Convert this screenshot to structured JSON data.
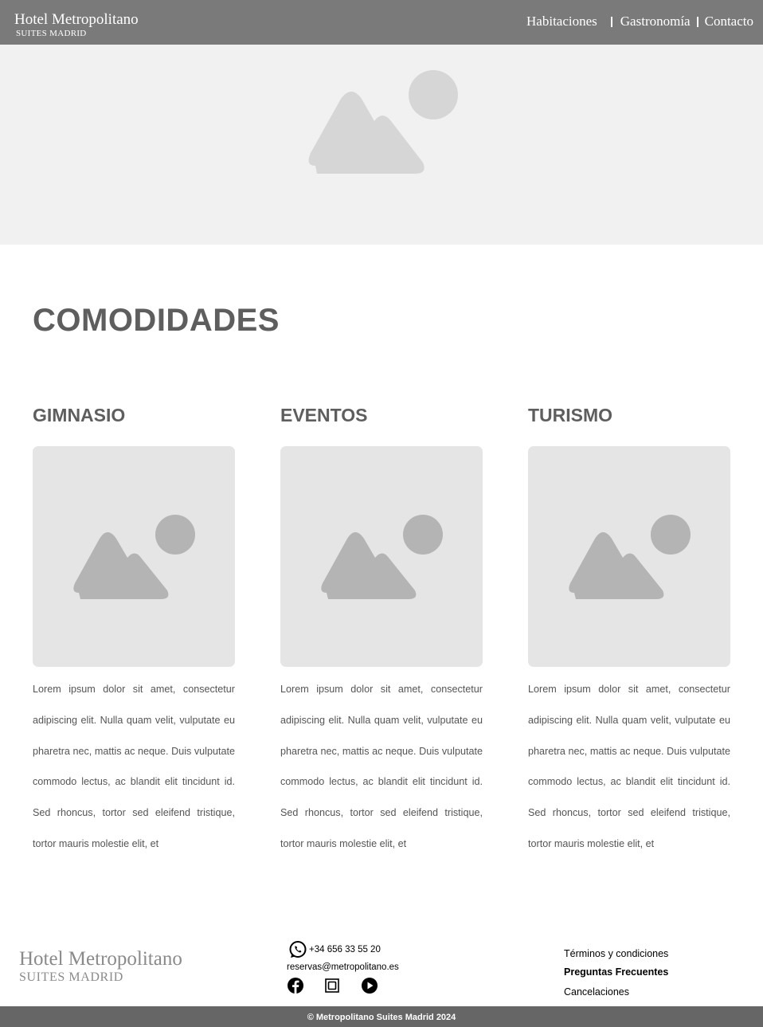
{
  "header": {
    "brand_title": "Hotel Metropolitano",
    "brand_sub": "SUITES MADRID",
    "nav": [
      "Habitaciones",
      "Gastronomía",
      "Contacto"
    ]
  },
  "hero": {
    "image_icon": "image-placeholder-icon"
  },
  "section": {
    "title": "COMODIDADES"
  },
  "cards": [
    {
      "title": "GIMNASIO",
      "text": "Lorem ipsum dolor sit amet, consectetur adipiscing elit. Nulla quam velit, vulputate eu pharetra nec, mattis ac neque. Duis vulputate commodo lectus, ac blandit elit tincidunt id. Sed rhoncus, tortor sed eleifend tristique, tortor mauris molestie elit, et"
    },
    {
      "title": "EVENTOS",
      "text": "Lorem ipsum dolor sit amet, consectetur adipiscing elit. Nulla quam velit, vulputate eu pharetra nec, mattis ac neque. Duis vulputate commodo lectus, ac blandit elit tincidunt id. Sed rhoncus, tortor sed eleifend tristique, tortor mauris molestie elit, et"
    },
    {
      "title": "TURISMO",
      "text": "Lorem ipsum dolor sit amet, consectetur adipiscing elit. Nulla quam velit, vulputate eu pharetra nec, mattis ac neque. Duis vulputate commodo lectus, ac blandit elit tincidunt id. Sed rhoncus, tortor sed eleifend tristique, tortor mauris molestie elit, et"
    }
  ],
  "footer": {
    "brand_title": "Hotel Metropolitano",
    "brand_sub": "SUITES MADRID",
    "phone": "+34 656 33 55 20",
    "email": "reservas@metropolitano.es",
    "social_icons": [
      "facebook-icon",
      "instagram-icon",
      "youtube-icon"
    ],
    "links": [
      "Términos y condiciones",
      "Preguntas Frecuentes",
      "Cancelaciones"
    ],
    "copyright": "© Metropolitano Suites Madrid 2024"
  },
  "colors": {
    "header_bg": "#7a7a7a",
    "hero_bg": "#f1f1f1",
    "card_image_bg": "#e5e5e5",
    "heading": "#5e5e5e",
    "bottom_bar": "#666666"
  }
}
